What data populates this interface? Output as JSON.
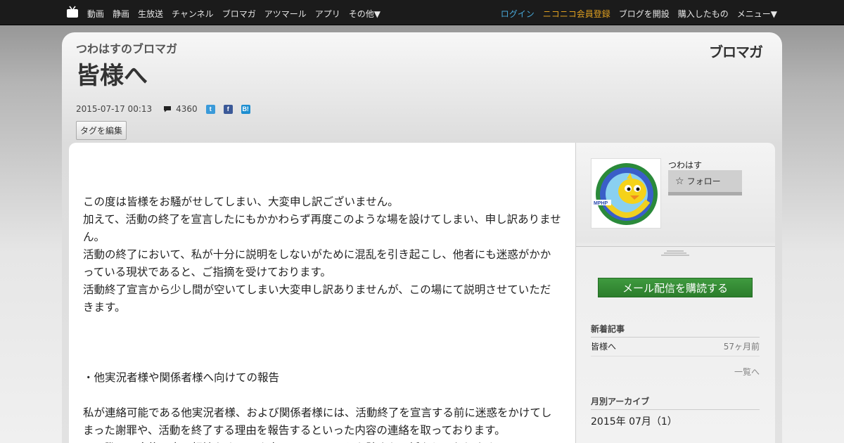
{
  "topnav": {
    "left": [
      "動画",
      "静画",
      "生放送",
      "チャンネル",
      "ブロマガ",
      "アツマール",
      "アプリ",
      "その他▼"
    ],
    "login": "ログイン",
    "premium": "ニコニコ会員登録",
    "open_blog": "ブログを開設",
    "purchased": "購入したもの",
    "menu": "メニュー▼"
  },
  "blog": {
    "name": "つわはすのブロマガ",
    "brand": "ブロマガ"
  },
  "article": {
    "title": "皆様へ",
    "date": "2015-07-17 00:13",
    "comment_count": "4360",
    "tag_edit": "タグを編集",
    "paragraphs": [
      "",
      "この度は皆様をお騒がせしてしまい、大変申し訳ございません。",
      "加えて、活動の終了を宣言したにもかかわらず再度このような場を設けてしまい、申し訳ありません。",
      "活動の終了において、私が十分に説明をしないがために混乱を引き起こし、他者にも迷惑がかかっている現状であると、ご指摘を受けております。",
      "活動終了宣言から少し間が空いてしまい大変申し訳ありませんが、この場にて説明させていただきます。",
      "",
      "",
      "",
      "・他実況者様や関係者様へ向けての報告",
      "",
      "私が連絡可能である他実況者様、および関係者様には、活動終了を宣言する前に迷惑をかけてしまった謝罪や、活動を終了する理由を報告するといった内容の連絡を取っております。",
      "その際に、今後の事の相談をするべき人には、そのことも踏まえて話をしております。"
    ]
  },
  "sidebar": {
    "author": "つわはす",
    "follow": "フォロー",
    "subscribe": "メール配信を購読する",
    "recent_title": "新着記事",
    "recent_items": [
      {
        "title": "皆様へ",
        "ago": "57ヶ月前"
      }
    ],
    "more": "一覧へ",
    "archive_title": "月別アーカイブ",
    "archive_items": [
      "2015年 07月（1）"
    ]
  },
  "colors": {
    "topbar": "#1b1b1b",
    "login": "#48a8d8",
    "premium": "#e0a020",
    "subscribe": "#2f8a2f"
  }
}
